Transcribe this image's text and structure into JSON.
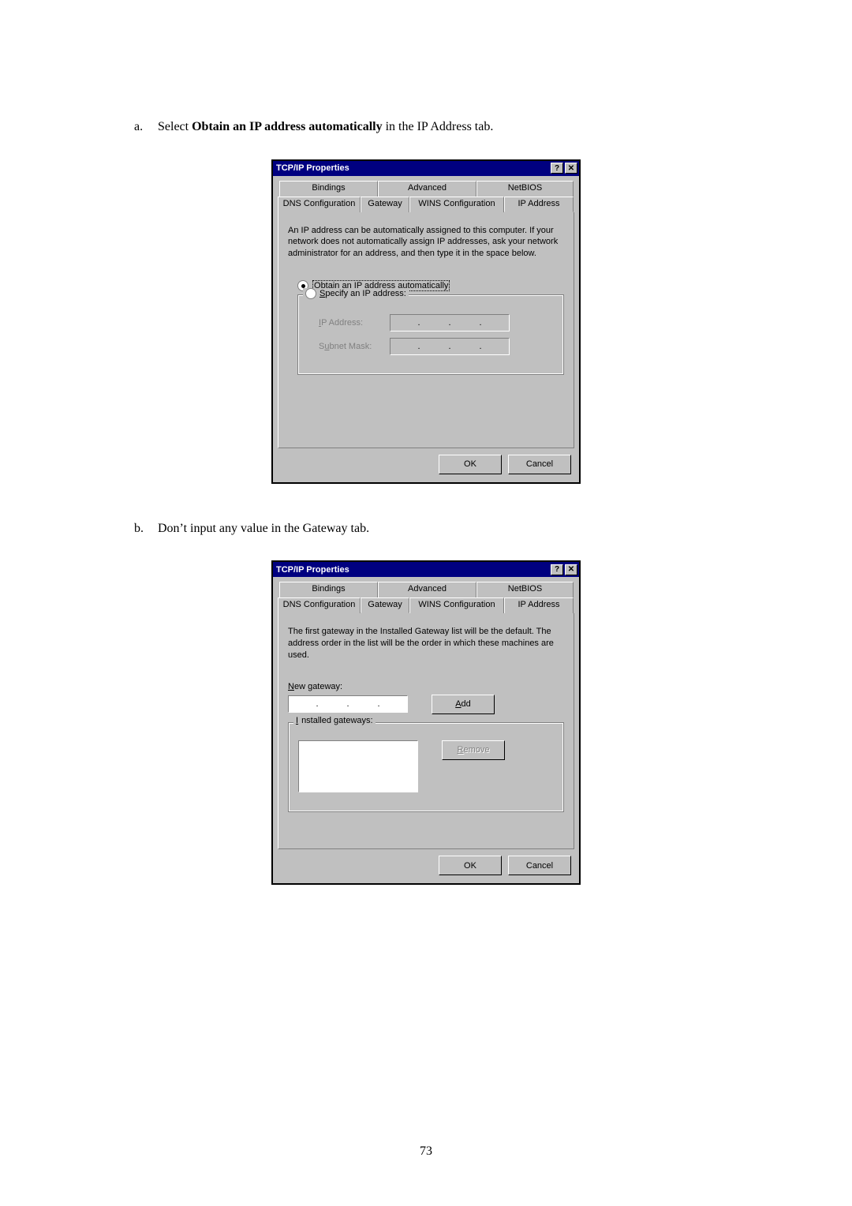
{
  "instructions": {
    "a_letter": "a.",
    "a_pre": "Select ",
    "a_bold": "Obtain an IP address automatically",
    "a_post": " in the IP Address tab.",
    "b_letter": "b.",
    "b_text": "Don’t input any value in the Gateway tab."
  },
  "dlg1": {
    "title": "TCP/IP Properties",
    "tabs_top": [
      "Bindings",
      "Advanced",
      "NetBIOS"
    ],
    "tabs_bottom": [
      "DNS Configuration",
      "Gateway",
      "WINS Configuration",
      "IP Address"
    ],
    "active_tab": "IP Address",
    "description": "An IP address can be automatically assigned to this computer. If your network does not automatically assign IP addresses, ask your network administrator for an address, and then type it in the space below.",
    "radio_auto_pref": "O",
    "radio_auto_rest": "btain an IP address automatically",
    "radio_spec_pref": "S",
    "radio_spec_rest": "pecify an IP address:",
    "ip_label_pref": "I",
    "ip_label_rest": "P Address:",
    "mask_label": "S",
    "mask_label_u": "u",
    "mask_label_rest": "bnet Mask:",
    "ok": "OK",
    "cancel": "Cancel"
  },
  "dlg2": {
    "title": "TCP/IP Properties",
    "tabs_top": [
      "Bindings",
      "Advanced",
      "NetBIOS"
    ],
    "tabs_bottom": [
      "DNS Configuration",
      "Gateway",
      "WINS Configuration",
      "IP Address"
    ],
    "active_tab": "Gateway",
    "description": "The first gateway in the Installed Gateway list will be the default. The address order in the list will be the order in which these machines are used.",
    "new_gw_pref": "N",
    "new_gw_rest": "ew gateway:",
    "add_pref": "A",
    "add_rest": "dd",
    "inst_pref": "I",
    "inst_rest": "nstalled gateways:",
    "remove_pref": "R",
    "remove_rest": "emove",
    "ok": "OK",
    "cancel": "Cancel"
  },
  "page_number": "73",
  "glyphs": {
    "help": "?",
    "close": "✕"
  }
}
